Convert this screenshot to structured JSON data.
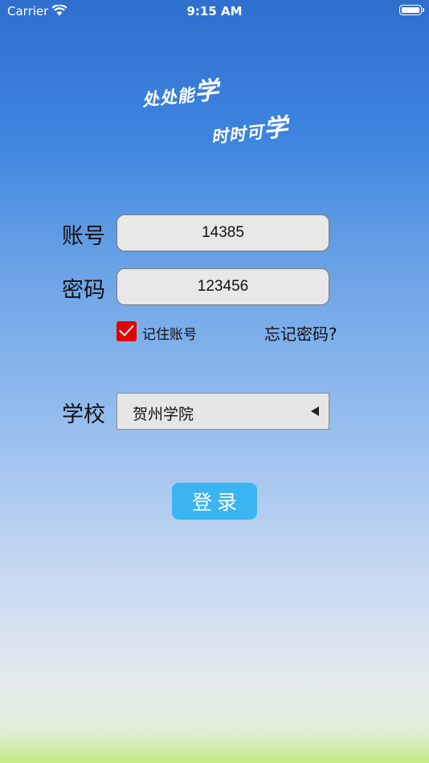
{
  "status_bar": {
    "carrier": "Carrier",
    "time": "9:15 AM",
    "wifi_icon": "wifi-icon",
    "battery_icon": "battery-icon"
  },
  "slogan": {
    "line1_prefix": "处处能",
    "line1_emph": "学",
    "line2_prefix": "时时可",
    "line2_emph": "学"
  },
  "form": {
    "account_label": "账号",
    "account_value": "14385",
    "password_label": "密码",
    "password_value": "123456",
    "remember_checked": true,
    "remember_label": "记住账号",
    "forgot_link": "忘记密码?",
    "school_label": "学校",
    "school_value": "贺州学院",
    "login_label": "登录"
  },
  "colors": {
    "checkbox_red": "#e00000",
    "login_button_blue": "#3ab5f1"
  }
}
